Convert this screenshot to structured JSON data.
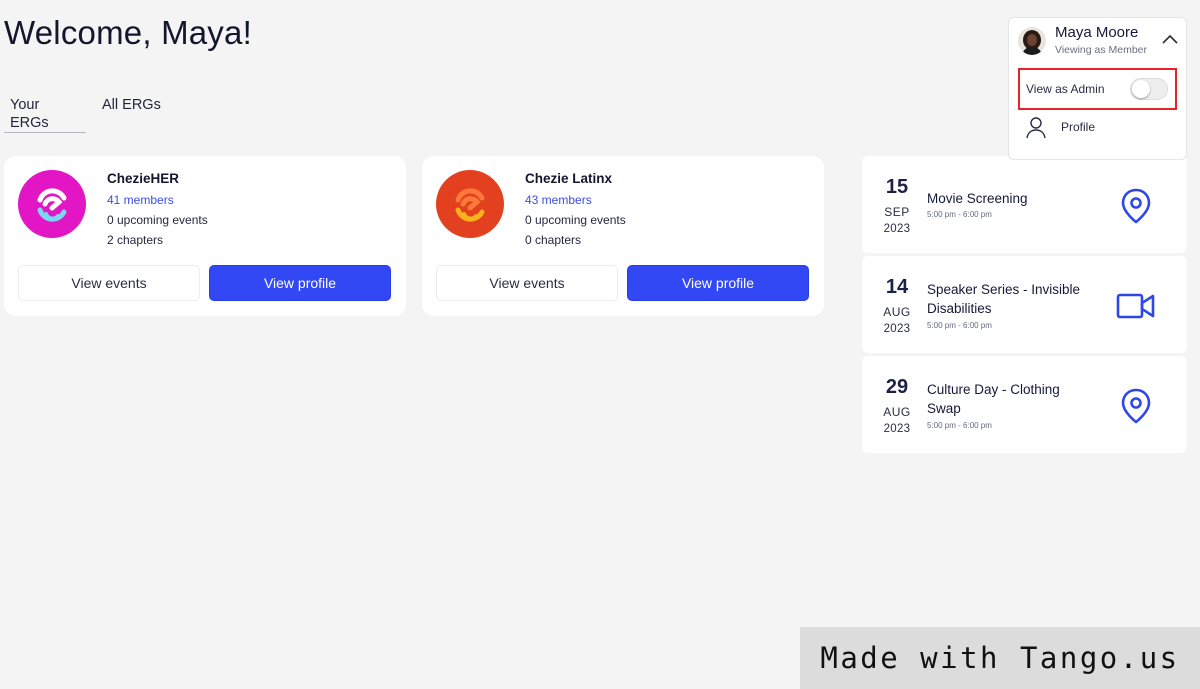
{
  "header": {
    "title": "Welcome, Maya!"
  },
  "tabs": [
    {
      "label": "Your ERGs",
      "active": true
    },
    {
      "label": "All ERGs",
      "active": false
    }
  ],
  "ergs": [
    {
      "name": "ChezieHER",
      "members": "41 members",
      "upcoming_events": "0 upcoming events",
      "chapters": "2 chapters",
      "view_events_label": "View events",
      "view_profile_label": "View profile",
      "logo_icon": "chezieher-logo",
      "logo_color": "#e316c6"
    },
    {
      "name": "Chezie Latinx",
      "members": "43 members",
      "upcoming_events": "0 upcoming events",
      "chapters": "0 chapters",
      "view_events_label": "View events",
      "view_profile_label": "View profile",
      "logo_icon": "chezie-latinx-logo",
      "logo_color": "#e3401f"
    }
  ],
  "events": [
    {
      "day": "15",
      "month": "SEP",
      "year": "2023",
      "title": "Movie Screening",
      "time": "5:00 pm - 6:00 pm",
      "icon": "location-pin-icon"
    },
    {
      "day": "14",
      "month": "AUG",
      "year": "2023",
      "title": "Speaker Series - Invisible Disabilities",
      "time": "5:00 pm - 6:00 pm",
      "icon": "video-camera-icon"
    },
    {
      "day": "29",
      "month": "AUG",
      "year": "2023",
      "title": "Culture Day - Clothing Swap",
      "time": "5:00 pm - 6:00 pm",
      "icon": "location-pin-icon"
    }
  ],
  "user_menu": {
    "name": "Maya Moore",
    "role": "Viewing as Member",
    "admin_toggle_label": "View as Admin",
    "admin_toggle_on": false,
    "profile_label": "Profile"
  },
  "watermark": {
    "text": "Made with Tango.us"
  },
  "colors": {
    "primary": "#3348f5",
    "accent_text": "#3a4ee6",
    "highlight": "#e8212b",
    "background": "#f4f4f4"
  }
}
